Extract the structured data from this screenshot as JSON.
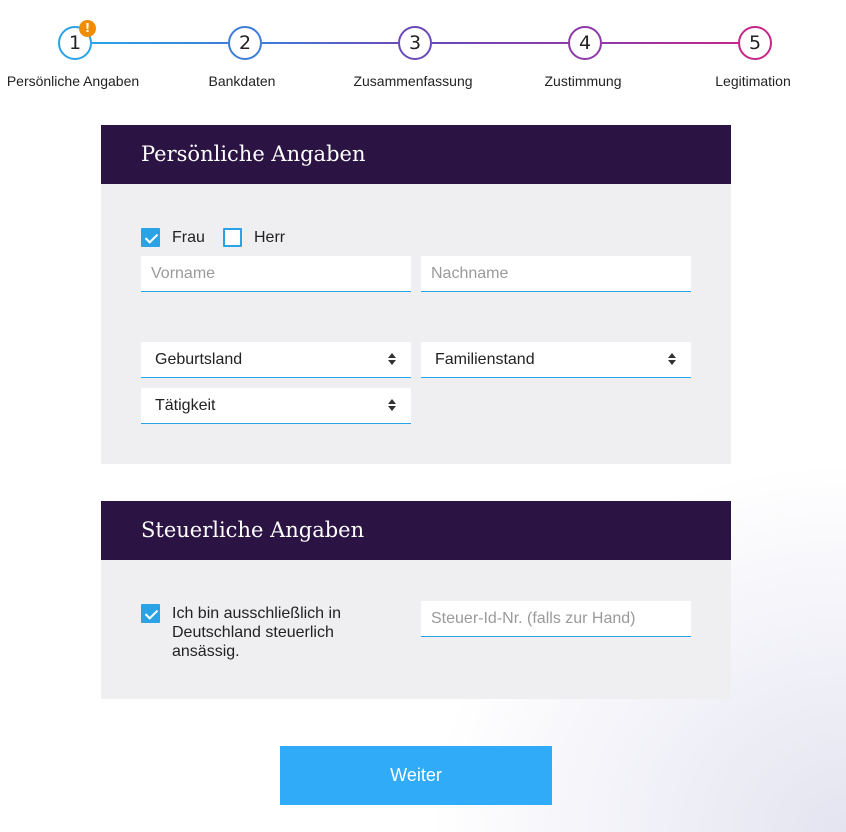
{
  "stepper": {
    "steps": [
      {
        "number": "1",
        "label": "Persönliche Angaben",
        "color": "#2aa3e6",
        "status": "warning"
      },
      {
        "number": "2",
        "label": "Bankdaten",
        "color": "#3e7ed8"
      },
      {
        "number": "3",
        "label": "Zusammenfassung",
        "color": "#6a4ab8"
      },
      {
        "number": "4",
        "label": "Zustimmung",
        "color": "#8e3aa8"
      },
      {
        "number": "5",
        "label": "Legitimation",
        "color": "#c3278a"
      }
    ],
    "warning_badge": "!"
  },
  "personal": {
    "title": "Persönliche Angaben",
    "salutation": {
      "frau_label": "Frau",
      "frau_checked": true,
      "herr_label": "Herr",
      "herr_checked": false
    },
    "vorname_placeholder": "Vorname",
    "nachname_placeholder": "Nachname",
    "geburtsland": "Geburtsland",
    "familienstand": "Familienstand",
    "taetigkeit": "Tätigkeit"
  },
  "tax": {
    "title": "Steuerliche Angaben",
    "resident_checked": true,
    "resident_label": "Ich bin ausschließlich in Deutschland steuerlich ansässig.",
    "tax_id_placeholder": "Steuer-Id-Nr. (falls zur Hand)"
  },
  "actions": {
    "next_label": "Weiter"
  },
  "colors": {
    "header_bg": "#2b1443",
    "card_bg": "#efeef1",
    "accent": "#2aa3e6",
    "button_bg": "#2fabf7",
    "warning": "#f08c00"
  }
}
